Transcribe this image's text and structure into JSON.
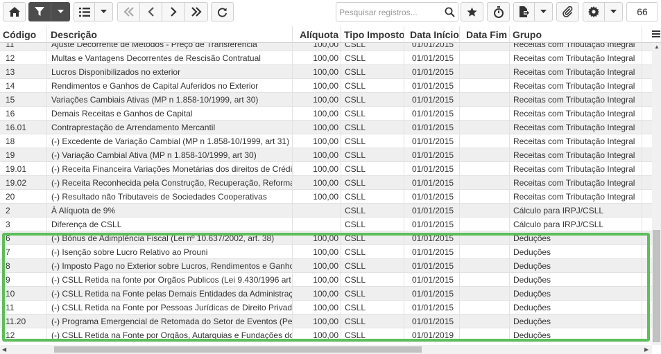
{
  "search": {
    "placeholder": "Pesquisar registros..."
  },
  "record_count": "66",
  "columns": [
    {
      "key": "codigo",
      "label": "Código"
    },
    {
      "key": "descricao",
      "label": "Descrição"
    },
    {
      "key": "aliquota",
      "label": "Alíquota"
    },
    {
      "key": "tipo",
      "label": "Tipo Imposto"
    },
    {
      "key": "inicio",
      "label": "Data Início"
    },
    {
      "key": "fim",
      "label": "Data Fim"
    },
    {
      "key": "grupo",
      "label": "Grupo"
    }
  ],
  "rows": [
    {
      "codigo": "11",
      "descricao": "Ajuste Decorrente de Métodos - Preço de Transferência",
      "aliquota": "100,00",
      "tipo": "CSLL",
      "inicio": "01/01/2015",
      "fim": "",
      "grupo": "Receitas com Tributação Integral"
    },
    {
      "codigo": "12",
      "descricao": "Multas e Vantagens Decorrentes de Rescisão Contratual",
      "aliquota": "100,00",
      "tipo": "CSLL",
      "inicio": "01/01/2015",
      "fim": "",
      "grupo": "Receitas com Tributação Integral"
    },
    {
      "codigo": "13",
      "descricao": "Lucros Disponibilizados no exterior",
      "aliquota": "100,00",
      "tipo": "CSLL",
      "inicio": "01/01/2015",
      "fim": "",
      "grupo": "Receitas com Tributação Integral"
    },
    {
      "codigo": "14",
      "descricao": "Rendimentos e Ganhos de Capital Auferidos no Exterior",
      "aliquota": "100,00",
      "tipo": "CSLL",
      "inicio": "01/01/2015",
      "fim": "",
      "grupo": "Receitas com Tributação Integral"
    },
    {
      "codigo": "15",
      "descricao": "Variações Cambiais Ativas (MP n 1.858-10/1999, art 30)",
      "aliquota": "100,00",
      "tipo": "CSLL",
      "inicio": "01/01/2015",
      "fim": "",
      "grupo": "Receitas com Tributação Integral"
    },
    {
      "codigo": "16",
      "descricao": "Demais Receitas e Ganhos de Capital",
      "aliquota": "100,00",
      "tipo": "CSLL",
      "inicio": "01/01/2015",
      "fim": "",
      "grupo": "Receitas com Tributação Integral"
    },
    {
      "codigo": "16.01",
      "descricao": "Contraprestação de Arrendamento Mercantil",
      "aliquota": "100,00",
      "tipo": "CSLL",
      "inicio": "01/01/2015",
      "fim": "",
      "grupo": "Receitas com Tributação Integral"
    },
    {
      "codigo": "18",
      "descricao": "(-) Excedente de Variação Cambial (MP n 1.858-10/1999, art 31)",
      "aliquota": "100,00",
      "tipo": "CSLL",
      "inicio": "01/01/2015",
      "fim": "",
      "grupo": "Receitas com Tributação Integral"
    },
    {
      "codigo": "19",
      "descricao": "(-) Variação Cambial Ativa (MP n 1.858-10/1999, art 30)",
      "aliquota": "100,00",
      "tipo": "CSLL",
      "inicio": "01/01/2015",
      "fim": "",
      "grupo": "Receitas com Tributação Integral"
    },
    {
      "codigo": "19.01",
      "descricao": "(-) Receita Financeira Variações Monetárias dos direitos de Crédi",
      "aliquota": "100,00",
      "tipo": "CSLL",
      "inicio": "01/01/2015",
      "fim": "",
      "grupo": "Receitas com Tributação Integral"
    },
    {
      "codigo": "19.02",
      "descricao": "(-) Receita Reconhecida pela Construção, Recuperação, Reforma",
      "aliquota": "100,00",
      "tipo": "CSLL",
      "inicio": "01/01/2015",
      "fim": "",
      "grupo": "Receitas com Tributação Integral"
    },
    {
      "codigo": "20",
      "descricao": "(-) Resultado não Tributaveis de Sociedades Cooperativas",
      "aliquota": "100,00",
      "tipo": "CSLL",
      "inicio": "01/01/2015",
      "fim": "",
      "grupo": "Receitas com Tributação Integral"
    },
    {
      "codigo": "2",
      "descricao": "À Alíquota de 9%",
      "aliquota": "",
      "tipo": "CSLL",
      "inicio": "01/01/2015",
      "fim": "",
      "grupo": "Cálculo para IRPJ/CSLL"
    },
    {
      "codigo": "3",
      "descricao": "Diferença de CSLL",
      "aliquota": "",
      "tipo": "CSLL",
      "inicio": "01/01/2015",
      "fim": "",
      "grupo": "Cálculo para IRPJ/CSLL"
    },
    {
      "codigo": "6",
      "descricao": "(-) Bônus de Adimplência Fiscal (Lei nº 10.637/2002, art. 38)",
      "aliquota": "100,00",
      "tipo": "CSLL",
      "inicio": "01/01/2015",
      "fim": "",
      "grupo": "Deduções"
    },
    {
      "codigo": "7",
      "descricao": "(-) Isenção sobre Lucro Relativo ao Prouni",
      "aliquota": "100,00",
      "tipo": "CSLL",
      "inicio": "01/01/2015",
      "fim": "",
      "grupo": "Deduções"
    },
    {
      "codigo": "8",
      "descricao": "(-) Imposto Pago no Exterior sobre Lucros, Rendimentos e Ganho",
      "aliquota": "100,00",
      "tipo": "CSLL",
      "inicio": "01/01/2015",
      "fim": "",
      "grupo": "Deduções"
    },
    {
      "codigo": "9",
      "descricao": "(-) CSLL Retida na fonte por Orgãos Publicos (Lei 9.430/1996 art",
      "aliquota": "100,00",
      "tipo": "CSLL",
      "inicio": "01/01/2015",
      "fim": "",
      "grupo": "Deduções"
    },
    {
      "codigo": "10",
      "descricao": "(-) CSLL Retida na Fonte pelas Demais Entidades da Administraç",
      "aliquota": "100,00",
      "tipo": "CSLL",
      "inicio": "01/01/2015",
      "fim": "",
      "grupo": "Deduções"
    },
    {
      "codigo": "11",
      "descricao": "(-) CSLL Retida na Fonte por Pessoas Jurídicas de Direito Privad",
      "aliquota": "100,00",
      "tipo": "CSLL",
      "inicio": "01/01/2015",
      "fim": "",
      "grupo": "Deduções"
    },
    {
      "codigo": "11.20",
      "descricao": "(-) Programa Emergencial de Retomada do Setor de Eventos (Pe",
      "aliquota": "100,00",
      "tipo": "CSLL",
      "inicio": "01/01/2015",
      "fim": "",
      "grupo": "Deduções"
    },
    {
      "codigo": "12",
      "descricao": "(-) CSLL Retida na Fonte por Orgãos, Autarquias e Fundações do",
      "aliquota": "100,00",
      "tipo": "CSLL",
      "inicio": "01/01/2019",
      "fim": "",
      "grupo": "Deduções"
    }
  ],
  "icons": {
    "home": "home-icon",
    "filter": "filter-icon",
    "list": "list-icon",
    "first": "first-page-icon",
    "prev": "previous-page-icon",
    "next": "next-page-icon",
    "last": "last-page-icon",
    "refresh": "refresh-icon",
    "search": "search-icon",
    "favorite": "star-icon",
    "timer": "stopwatch-icon",
    "export": "export-file-icon",
    "attach": "paperclip-icon",
    "settings": "gear-icon",
    "columns": "column-menu-icon"
  },
  "colors": {
    "highlight": "#5cbf5a",
    "active_button": "#4d4d4d",
    "alt_row": "#efefef"
  }
}
